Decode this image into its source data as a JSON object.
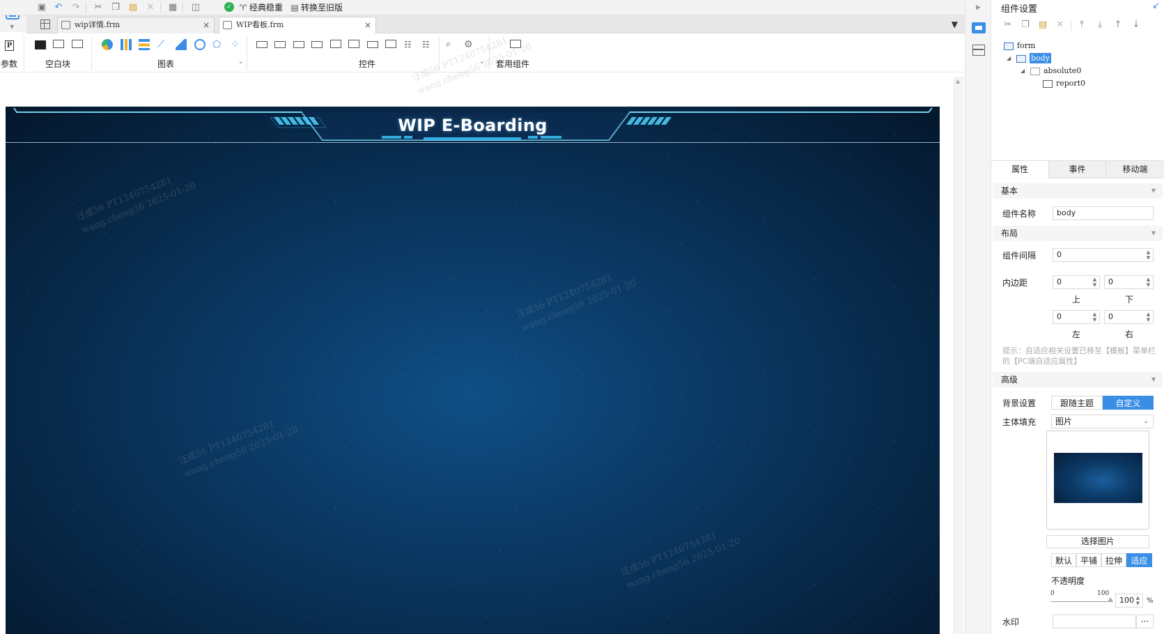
{
  "toolbar": {
    "classic_label": "经典稳重",
    "convert_label": "转换至旧版"
  },
  "tabs": [
    {
      "label": "wip详情.frm",
      "active": false
    },
    {
      "label": "WIP看板.frm",
      "active": true
    }
  ],
  "ribbon": {
    "params_label": "参数",
    "blank_label": "空白块",
    "chart_label": "图表",
    "widget_label": "控件",
    "template_label": "套用组件"
  },
  "canvas": {
    "title": "WIP E-Boarding"
  },
  "watermark": {
    "line1": "汪成56 PT1240754281",
    "line2": "wang.cheng56 2025-01-20"
  },
  "panel": {
    "title": "组件设置",
    "tree": {
      "form": "form",
      "body": "body",
      "absolute": "absolute0",
      "report": "report0"
    },
    "tabs": [
      "属性",
      "事件",
      "移动端"
    ],
    "basic_section": "基本",
    "name_label": "组件名称",
    "name_value": "body",
    "layout_section": "布局",
    "gap_label": "组件间隔",
    "gap_value": "0",
    "padding_label": "内边距",
    "pad_top": "0",
    "pad_bottom": "0",
    "pad_left": "0",
    "pad_right": "0",
    "top_label": "上",
    "bottom_label": "下",
    "left_label": "左",
    "right_label": "右",
    "hint": "提示：自适应相关设置已移至【模板】菜单栏的【PC端自适应属性】",
    "advanced_section": "高级",
    "bg_label": "背景设置",
    "bg_follow": "跟随主题",
    "bg_custom": "自定义",
    "fill_label": "主体填充",
    "fill_value": "图片",
    "choose_image": "选择图片",
    "mode_default": "默认",
    "mode_tile": "平铺",
    "mode_stretch": "拉伸",
    "mode_fit": "适应",
    "opacity_label": "不透明度",
    "opacity_min": "0",
    "opacity_max": "100",
    "opacity_value": "100",
    "opacity_unit": "%",
    "watermark_label": "水印",
    "watermark_btn": "···"
  }
}
